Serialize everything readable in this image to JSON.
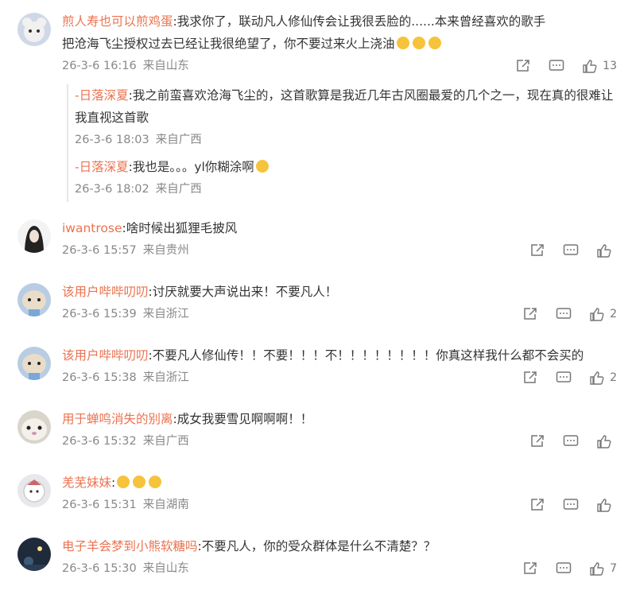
{
  "comments": [
    {
      "user": "煎人寿也可以煎鸡蛋",
      "text": ":我求你了，联动凡人修仙传会让我很丢脸的......本来曾经喜欢的歌手把沧海飞尘授权过去已经让我很绝望了，你不要过来火上浇油",
      "emojis": [
        "smile-emoji",
        "smile-emoji",
        "smile-emoji"
      ],
      "time": "26-3-6 16:16",
      "location": "来自山东",
      "likes": "13",
      "replies": [
        {
          "user": "-日落深夏",
          "text": ":我之前蛮喜欢沧海飞尘的，这首歌算是我近几年古风圈最爱的几个之一，现在真的很难让我直视这首歌",
          "time": "26-3-6 18:03",
          "location": "来自广西"
        },
        {
          "user": "-日落深夏",
          "text": ":我也是。。。yl你糊涂啊",
          "time": "26-3-6 18:02",
          "location": "来自广西"
        }
      ]
    },
    {
      "user": "iwantrose",
      "text": ":啥时候出狐狸毛披风",
      "time": "26-3-6 15:57",
      "location": "来自贵州",
      "likes": ""
    },
    {
      "user": "该用户哔哔叨叨",
      "text": ":讨厌就要大声说出来！不要凡人！",
      "time": "26-3-6 15:39",
      "location": "来自浙江",
      "likes": "2"
    },
    {
      "user": "该用户哔哔叨叨",
      "text": ":不要凡人修仙传！！不要！！！不！！！！！！！！你真这样我什么都不会买的",
      "time": "26-3-6 15:38",
      "location": "来自浙江",
      "likes": "2"
    },
    {
      "user": "用于蝉鸣消失的别离",
      "text": ":成女我要雪见啊啊啊！！",
      "time": "26-3-6 15:32",
      "location": "来自广西",
      "likes": ""
    },
    {
      "user": "羌芜妹妹",
      "text": ":",
      "emojis": [
        "grin-emoji",
        "grin-emoji",
        "grin-emoji"
      ],
      "time": "26-3-6 15:31",
      "location": "来自湖南",
      "likes": ""
    },
    {
      "user": "电子羊会梦到小熊软糖吗",
      "text": ":不要凡人，你的受众群体是什么不清楚？？",
      "time": "26-3-6 15:30",
      "location": "来自山东",
      "likes": "7"
    }
  ],
  "icons": {
    "share": "share-icon",
    "comment": "comment-icon",
    "like": "like-icon"
  },
  "colors": {
    "username": "#eb7350",
    "meta": "#888888",
    "text": "#333333"
  }
}
